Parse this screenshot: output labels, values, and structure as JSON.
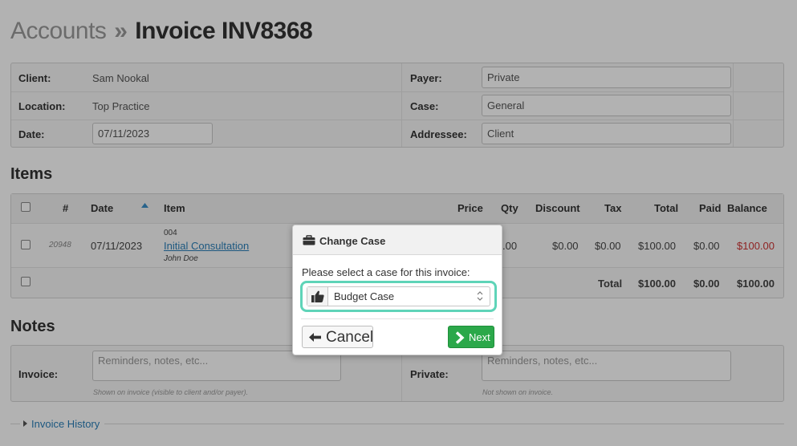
{
  "title": {
    "crumb": "Accounts",
    "separator": "»",
    "current": "Invoice INV8368"
  },
  "invoice_info": {
    "client_label": "Client:",
    "client_value": "Sam Nookal",
    "location_label": "Location:",
    "location_value": "Top Practice",
    "date_label": "Date:",
    "date_value": "07/11/2023",
    "payer_label": "Payer:",
    "payer_value": "Private",
    "case_label": "Case:",
    "case_value": "General",
    "addressee_label": "Addressee:",
    "addressee_value": "Client"
  },
  "items": {
    "heading": "Items",
    "columns": {
      "number": "#",
      "date": "Date",
      "item": "Item",
      "price": "Price",
      "qty": "Qty",
      "discount": "Discount",
      "tax": "Tax",
      "total": "Total",
      "paid": "Paid",
      "balance": "Balance"
    },
    "rows": [
      {
        "id": "20948",
        "date": "07/11/2023",
        "code": "004",
        "name": "Initial Consultation",
        "practitioner": "John Doe",
        "qty": ".00",
        "discount": "$0.00",
        "tax": "$0.00",
        "total": "$100.00",
        "paid": "$0.00",
        "balance": "$100.00"
      }
    ],
    "totals": {
      "label": "Total",
      "total": "$100.00",
      "paid": "$0.00",
      "balance": "$100.00"
    }
  },
  "notes": {
    "heading": "Notes",
    "invoice_label": "Invoice:",
    "invoice_placeholder": "Reminders, notes, etc...",
    "invoice_help": "Shown on invoice (visible to client and/or payer).",
    "private_label": "Private:",
    "private_placeholder": "Reminders, notes, etc...",
    "private_help": "Not shown on invoice."
  },
  "history": {
    "label": "Invoice History"
  },
  "modal": {
    "title": "Change Case",
    "prompt": "Please select a case for this invoice:",
    "selected_case": "Budget Case",
    "cancel_label": "Cancel",
    "next_label": "Next",
    "focus_color": "#5fd4b8",
    "next_color": "#2ba84a"
  }
}
